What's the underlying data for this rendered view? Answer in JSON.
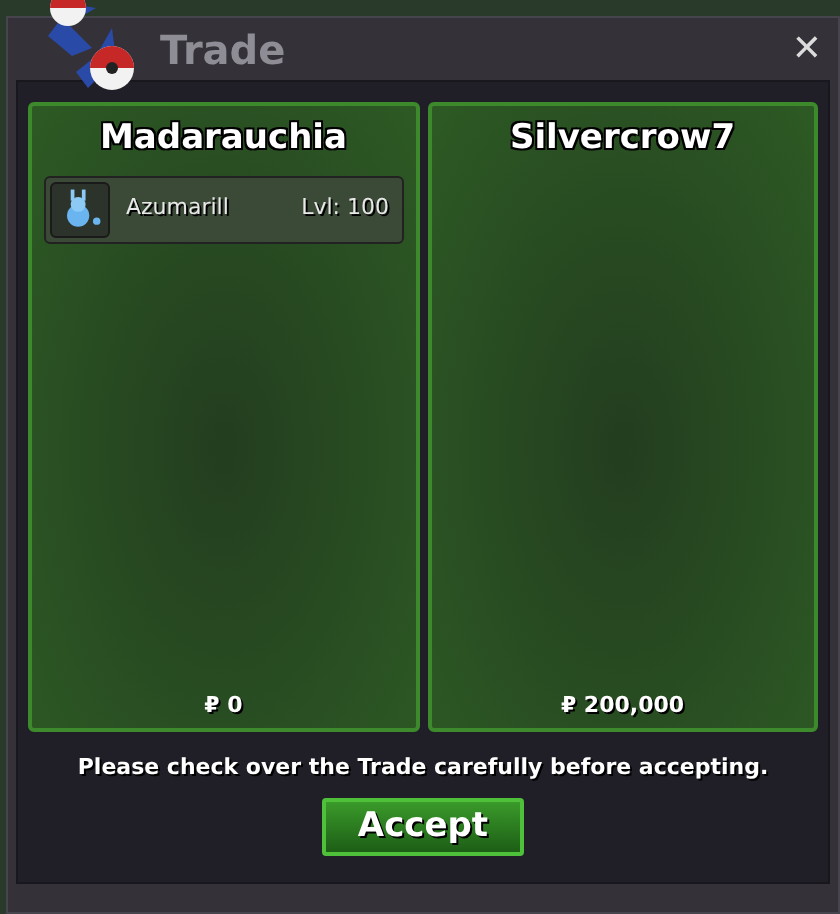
{
  "window": {
    "title": "Trade",
    "close": "✕"
  },
  "offers": [
    {
      "trader": "Madarauchia",
      "pokemon": [
        {
          "name": "Azumarill",
          "level": "Lvl: 100"
        }
      ],
      "money": "₽ 0"
    },
    {
      "trader": "Silvercrow7",
      "money": "₽ 200,000"
    }
  ],
  "notice": "Please check over the Trade carefully before accepting.",
  "buttons": [
    "Accept"
  ]
}
